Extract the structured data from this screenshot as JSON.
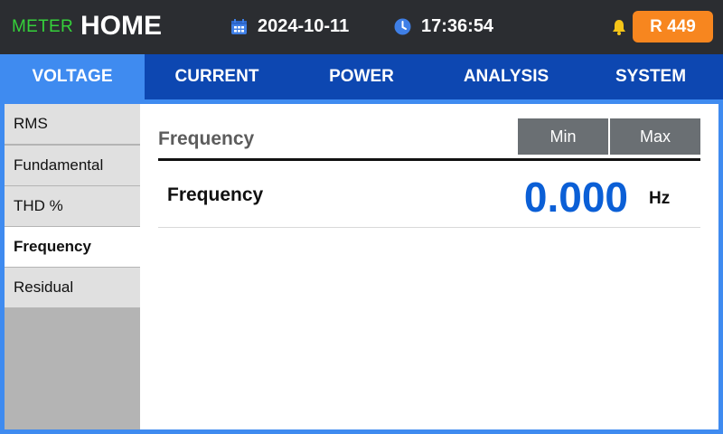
{
  "header": {
    "brand_prefix": "METER",
    "brand_title": "HOME",
    "date": "2024-10-11",
    "time": "17:36:54",
    "badge": "R 449",
    "calendar_icon": "calendar-icon",
    "clock_icon": "clock-icon",
    "bell_icon": "bell-icon",
    "colors": {
      "bar": "#2b2d31",
      "brand_prefix": "#35d13a",
      "badge": "#f7861f",
      "bell": "#f5c518"
    }
  },
  "tabs": [
    {
      "label": "VOLTAGE",
      "active": true
    },
    {
      "label": "CURRENT",
      "active": false
    },
    {
      "label": "POWER",
      "active": false
    },
    {
      "label": "ANALYSIS",
      "active": false
    },
    {
      "label": "SYSTEM",
      "active": false
    }
  ],
  "sidebar": {
    "items": [
      {
        "label": "RMS",
        "active": false
      },
      {
        "label": "Fundamental",
        "active": false
      },
      {
        "label": "THD %",
        "active": false
      },
      {
        "label": "Frequency",
        "active": true
      },
      {
        "label": "Residual",
        "active": false
      }
    ]
  },
  "main": {
    "section_title": "Frequency",
    "min_label": "Min",
    "max_label": "Max",
    "row": {
      "label": "Frequency",
      "value": "0.000",
      "unit": "Hz"
    },
    "colors": {
      "value": "#0b5fd6",
      "tab_active": "#3f8bf0",
      "tab_bar": "#0d47b1"
    }
  }
}
